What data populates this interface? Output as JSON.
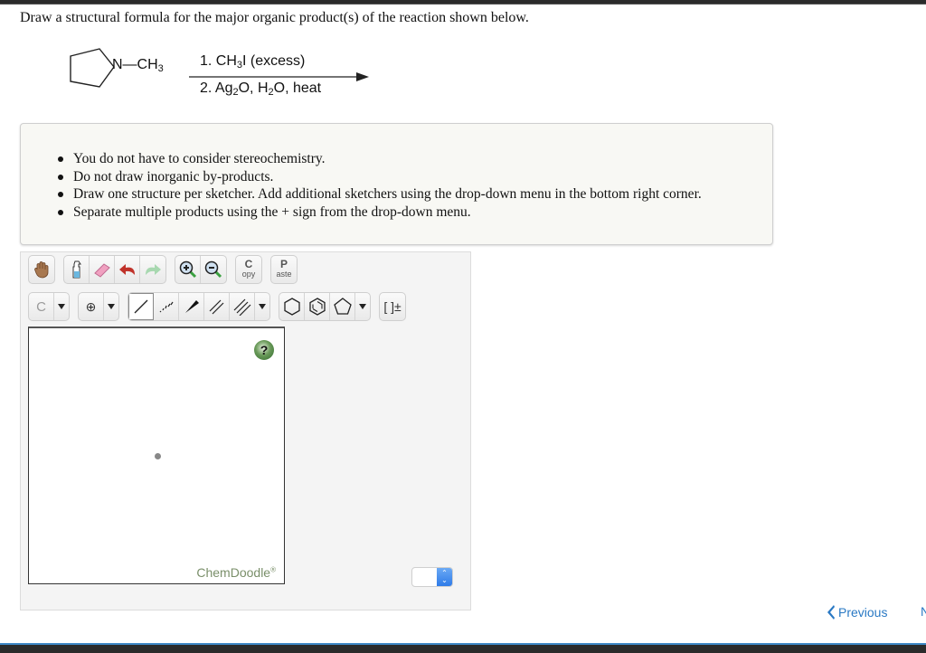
{
  "question": "Draw a structural formula for the major organic product(s) of the reaction shown below.",
  "reaction": {
    "reactant_substituent": "N—CH",
    "reactant_sub": "3",
    "step1_a": "1. CH",
    "step1_sub": "3",
    "step1_b": "I  (excess)",
    "step2_a": "2. Ag",
    "step2_sub1": "2",
    "step2_b": "O, H",
    "step2_sub2": "2",
    "step2_c": "O, heat"
  },
  "notes": [
    "You do not have to consider stereochemistry.",
    "Do not draw inorganic by-products.",
    "Draw one structure per sketcher. Add additional sketchers using the drop-down menu in the bottom right corner.",
    "Separate multiple products using the + sign from the drop-down menu."
  ],
  "toolbar": {
    "copy_big": "C",
    "copy_small": "opy",
    "paste_big": "P",
    "paste_small": "aste",
    "element_label": "C",
    "charge_label": "⊕",
    "bracket_label": "[ ]±"
  },
  "canvas": {
    "help_label": "?",
    "brand": "ChemDoodle",
    "brand_mark": "®"
  },
  "navigation": {
    "previous_label": "Previous",
    "next_label": "N"
  }
}
